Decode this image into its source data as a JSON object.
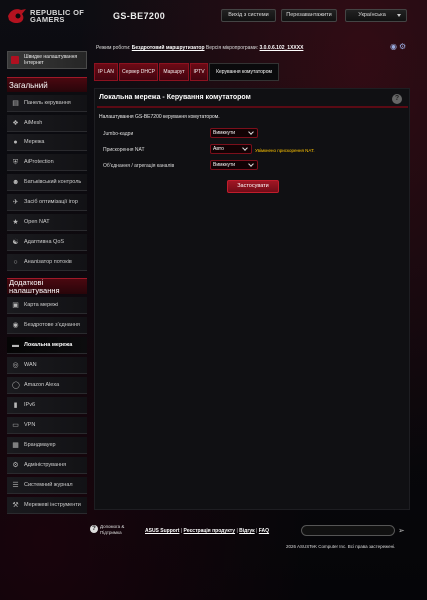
{
  "header": {
    "brand_line1": "REPUBLIC OF",
    "brand_line2": "GAMERS",
    "model": "GS-BE7200",
    "logout_label": "Вихід з системи",
    "reboot_label": "Перезавантажити",
    "language": "Українська"
  },
  "status": {
    "mode_label": "Режим роботи:",
    "mode_value": "Бездротовий маршрутизатор",
    "firmware_label": "Версія мікропрограми:",
    "firmware_value": "3.0.0.6.102_1XXXX"
  },
  "sidebar": {
    "quick_setup": "Швидке налаштування Інтернет",
    "general_header": "Загальний",
    "general_items": [
      {
        "label": "Панель керування",
        "icon": "dashboard-icon"
      },
      {
        "label": "AiMesh",
        "icon": "mesh-icon"
      },
      {
        "label": "Мережа",
        "icon": "network-icon"
      },
      {
        "label": "AiProtection",
        "icon": "shield-icon"
      },
      {
        "label": "Батьківський контроль",
        "icon": "parental-icon"
      },
      {
        "label": "Засіб оптимізації ігор",
        "icon": "game-boost-icon"
      },
      {
        "label": "Open NAT",
        "icon": "open-nat-icon"
      },
      {
        "label": "Адаптивна QoS",
        "icon": "qos-icon"
      },
      {
        "label": "Аналізатор потоків",
        "icon": "traffic-analyzer-icon"
      }
    ],
    "advanced_header": "Додаткові налаштування",
    "advanced_items": [
      {
        "label": "Карта мережі",
        "icon": "network-map-icon"
      },
      {
        "label": "Бездротове з'єднання",
        "icon": "wireless-icon"
      },
      {
        "label": "Локальна мережа",
        "icon": "lan-icon"
      },
      {
        "label": "WAN",
        "icon": "wan-icon"
      },
      {
        "label": "Amazon Alexa",
        "icon": "alexa-icon"
      },
      {
        "label": "IPv6",
        "icon": "ipv6-icon"
      },
      {
        "label": "VPN",
        "icon": "vpn-icon"
      },
      {
        "label": "Брандмауер",
        "icon": "firewall-icon"
      },
      {
        "label": "Адміністрування",
        "icon": "admin-icon"
      },
      {
        "label": "Системний журнал",
        "icon": "log-icon"
      },
      {
        "label": "Мережеві інструменти",
        "icon": "tools-icon"
      }
    ],
    "active_item": "Локальна мережа"
  },
  "tabs": [
    "IP LAN",
    "Сервер DHCP",
    "Маршрут",
    "IPTV",
    "Керування комутатором"
  ],
  "panel": {
    "title": "Локальна мережа - Керування комутатором",
    "description": "Налаштування GS-BE7200 керування комутатором.",
    "rows": [
      {
        "label": "Jumbo-кадри",
        "value": "Вимкнути"
      },
      {
        "label": "Прискорення NAT",
        "value": "Авто",
        "hint": "Увімкнено прискорення NAT."
      },
      {
        "label": "Об'єднання / агрегація каналів",
        "value": "Вимкнути"
      }
    ],
    "apply_label": "Застосувати"
  },
  "footer": {
    "help_line1": "Допомога &",
    "help_line2": "Підтримка",
    "links": [
      "ASUS Support",
      "Реєстрація продукту",
      "Відгук",
      "FAQ"
    ],
    "copyright": "2026 ASUSTeK Computer Inc. Всі права застережені."
  },
  "colors": {
    "accent": "#a01624",
    "hint": "#ffc400",
    "background": "#0a0a0c"
  }
}
